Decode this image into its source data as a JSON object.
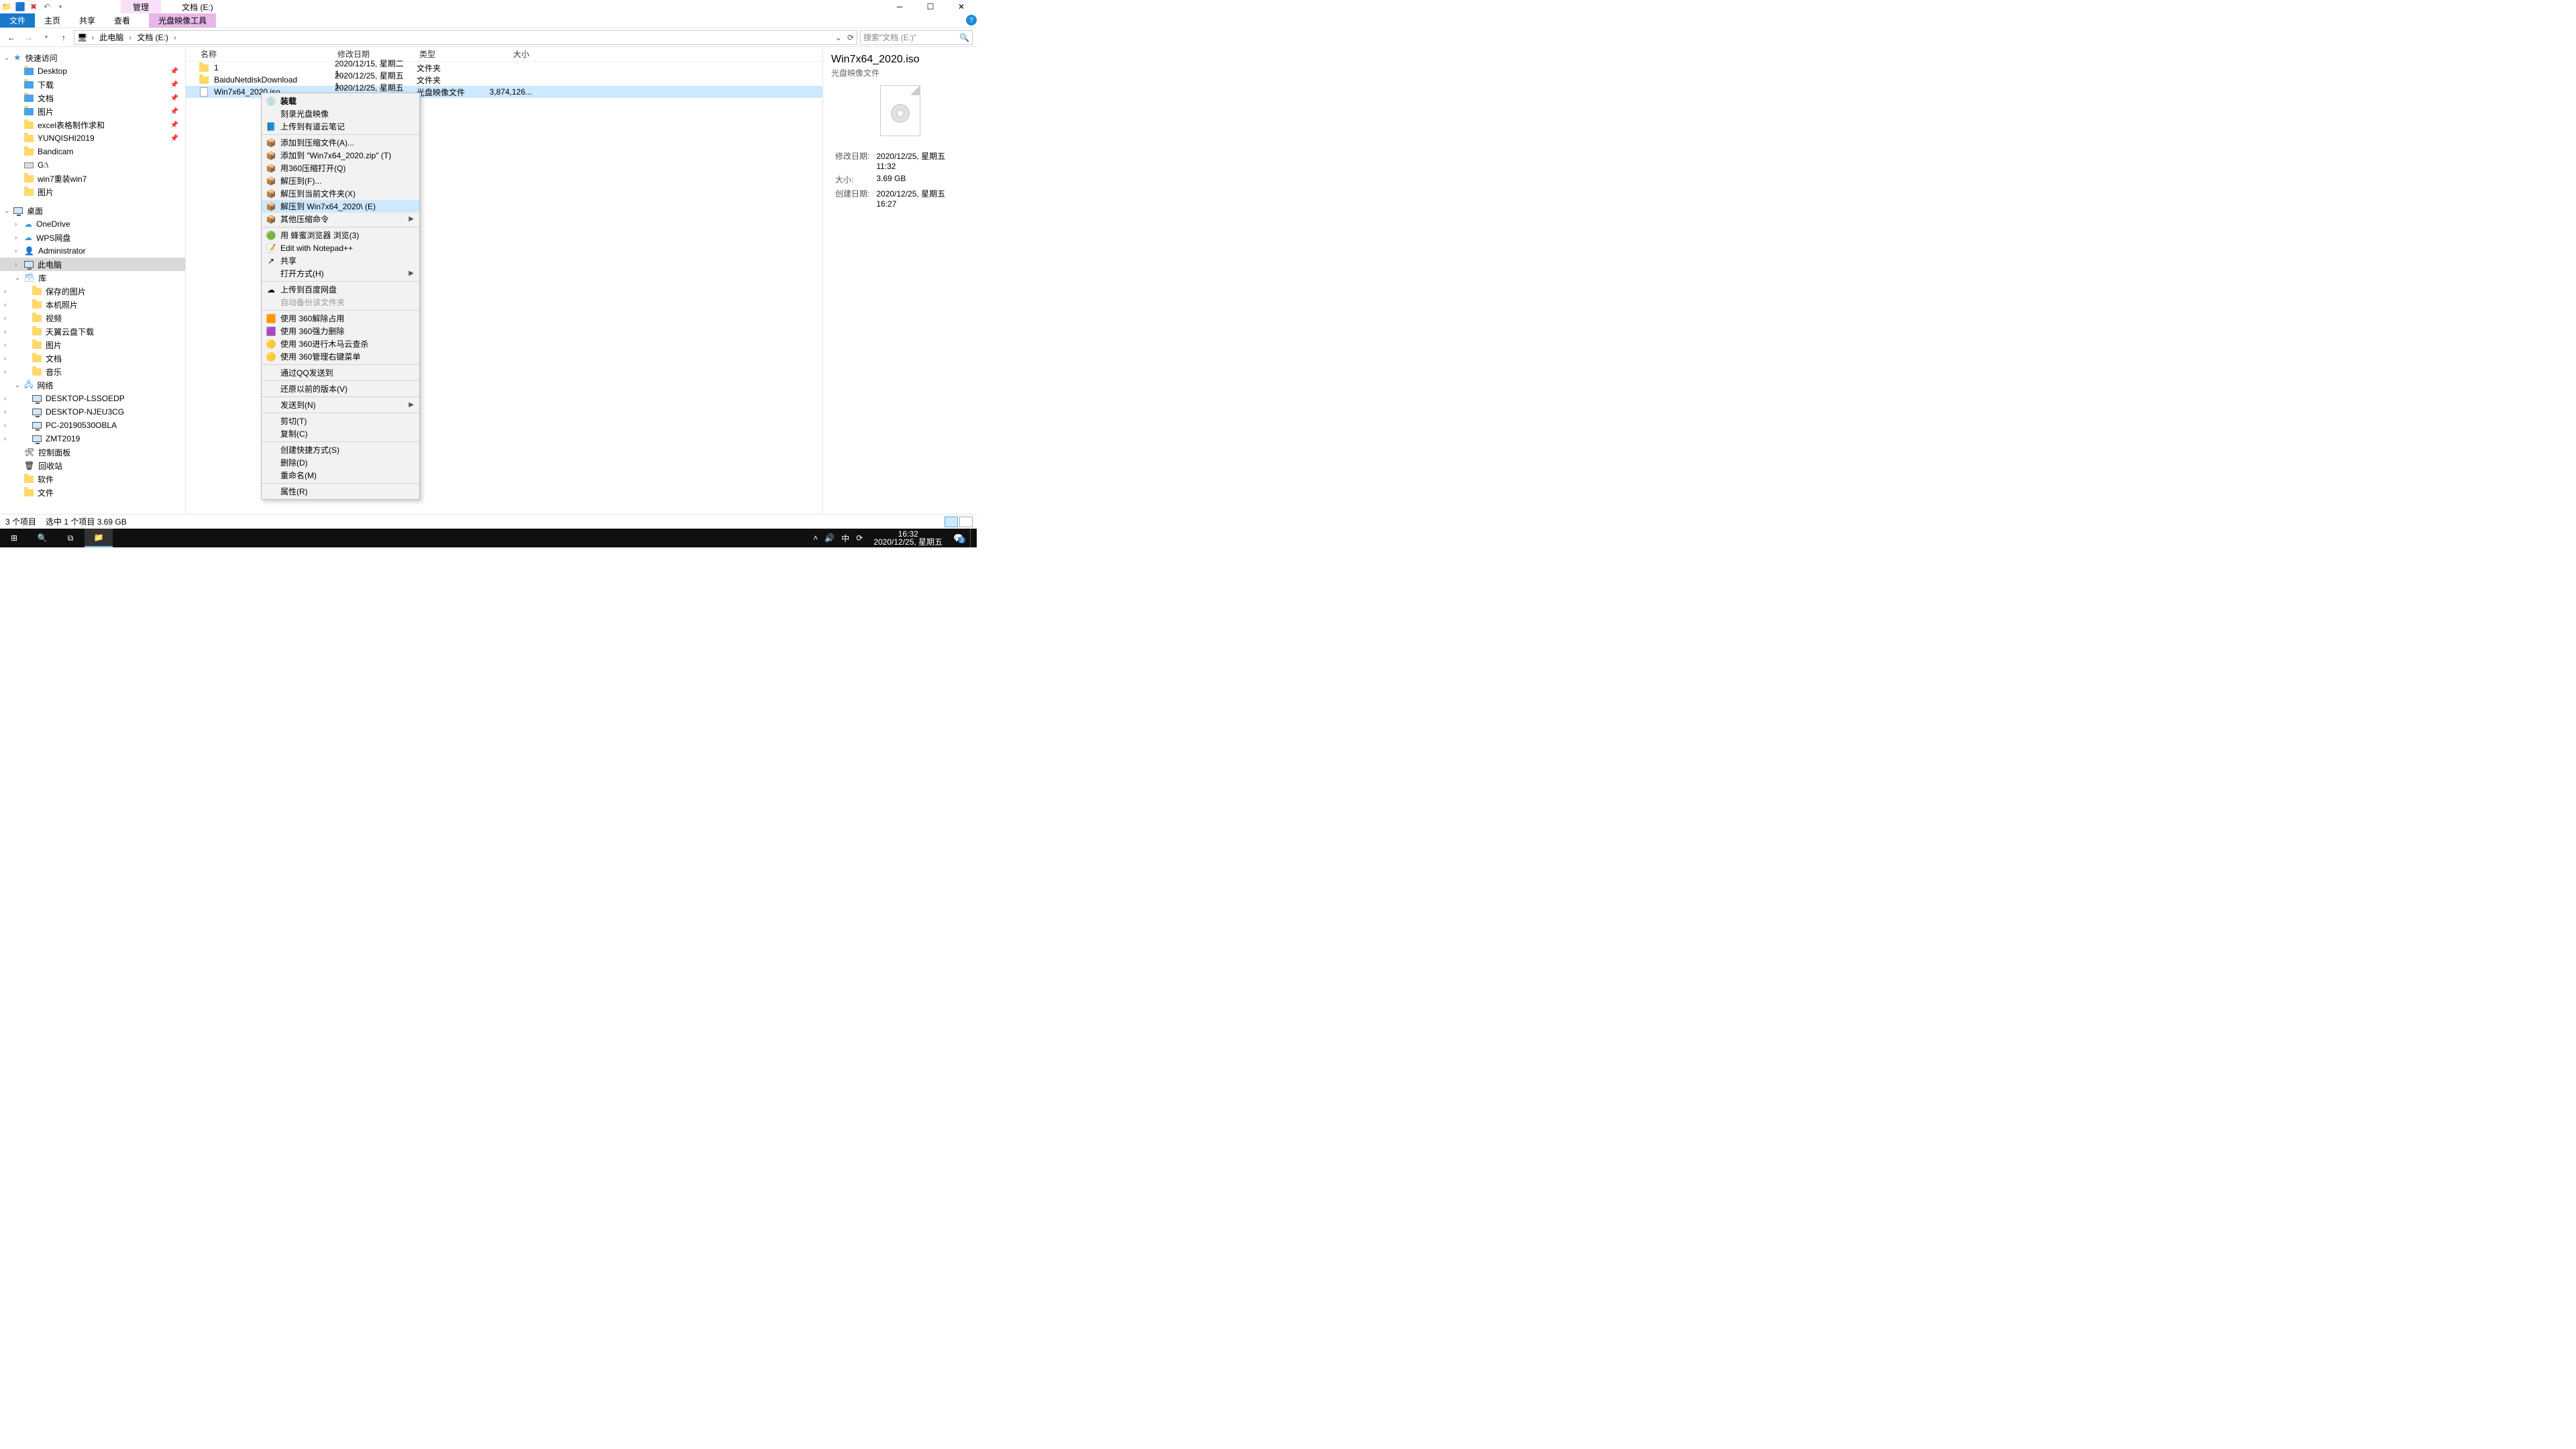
{
  "qat": {
    "manage_tab": "管理",
    "path_title": "文档 (E:)"
  },
  "ribbon": {
    "file": "文件",
    "home": "主页",
    "share": "共享",
    "view": "查看",
    "disc_tools": "光盘映像工具"
  },
  "nav": {
    "crumb_pc": "此电脑",
    "crumb_drive": "文档 (E:)",
    "search_placeholder": "搜索\"文档 (E:)\""
  },
  "columns": {
    "name": "名称",
    "date": "修改日期",
    "type": "类型",
    "size": "大小"
  },
  "rows": [
    {
      "name": "1",
      "date": "2020/12/15, 星期二 1...",
      "type": "文件夹",
      "size": "",
      "icon": "folder"
    },
    {
      "name": "BaiduNetdiskDownload",
      "date": "2020/12/25, 星期五 1...",
      "type": "文件夹",
      "size": "",
      "icon": "folder"
    },
    {
      "name": "Win7x64_2020.iso",
      "date": "2020/12/25, 星期五 1...",
      "type": "光盘映像文件",
      "size": "3,874,126...",
      "icon": "file",
      "selected": true
    }
  ],
  "tree": [
    {
      "t": "快速访问",
      "d": 0,
      "exp": "v",
      "ic": "star"
    },
    {
      "t": "Desktop",
      "d": 1,
      "pin": true,
      "ic": "folder-blue"
    },
    {
      "t": "下载",
      "d": 1,
      "pin": true,
      "ic": "folder-blue"
    },
    {
      "t": "文档",
      "d": 1,
      "pin": true,
      "ic": "folder-blue"
    },
    {
      "t": "图片",
      "d": 1,
      "pin": true,
      "ic": "folder-blue"
    },
    {
      "t": "excel表格制作求和",
      "d": 1,
      "pin": true,
      "ic": "folder"
    },
    {
      "t": "YUNQISHI2019",
      "d": 1,
      "pin": true,
      "ic": "folder"
    },
    {
      "t": "Bandicam",
      "d": 1,
      "ic": "folder"
    },
    {
      "t": "G:\\",
      "d": 1,
      "ic": "drive"
    },
    {
      "t": "win7重装win7",
      "d": 1,
      "ic": "folder"
    },
    {
      "t": "图片",
      "d": 1,
      "ic": "folder"
    },
    {
      "gap": true
    },
    {
      "t": "桌面",
      "d": 0,
      "exp": "v",
      "ic": "monitor"
    },
    {
      "t": "OneDrive",
      "d": 1,
      "exp": ">",
      "ic": "cloud"
    },
    {
      "t": "WPS网盘",
      "d": 1,
      "exp": ">",
      "ic": "cloud"
    },
    {
      "t": "Administrator",
      "d": 1,
      "exp": ">",
      "ic": "user"
    },
    {
      "t": "此电脑",
      "d": 1,
      "exp": ">",
      "ic": "monitor",
      "sel": true
    },
    {
      "t": "库",
      "d": 1,
      "exp": "v",
      "ic": "lib"
    },
    {
      "t": "保存的图片",
      "d": 2,
      "exp": ">",
      "ic": "folder"
    },
    {
      "t": "本机照片",
      "d": 2,
      "exp": ">",
      "ic": "folder"
    },
    {
      "t": "视频",
      "d": 2,
      "exp": ">",
      "ic": "folder"
    },
    {
      "t": "天翼云盘下载",
      "d": 2,
      "exp": ">",
      "ic": "folder"
    },
    {
      "t": "图片",
      "d": 2,
      "exp": ">",
      "ic": "folder"
    },
    {
      "t": "文档",
      "d": 2,
      "exp": ">",
      "ic": "folder"
    },
    {
      "t": "音乐",
      "d": 2,
      "exp": ">",
      "ic": "folder"
    },
    {
      "t": "网络",
      "d": 1,
      "exp": "v",
      "ic": "net"
    },
    {
      "t": "DESKTOP-LSSOEDP",
      "d": 2,
      "exp": ">",
      "ic": "monitor"
    },
    {
      "t": "DESKTOP-NJEU3CG",
      "d": 2,
      "exp": ">",
      "ic": "monitor"
    },
    {
      "t": "PC-20190530OBLA",
      "d": 2,
      "exp": ">",
      "ic": "monitor"
    },
    {
      "t": "ZMT2019",
      "d": 2,
      "exp": ">",
      "ic": "monitor"
    },
    {
      "t": "控制面板",
      "d": 1,
      "ic": "cp"
    },
    {
      "t": "回收站",
      "d": 1,
      "ic": "bin"
    },
    {
      "t": "软件",
      "d": 1,
      "ic": "folder"
    },
    {
      "t": "文件",
      "d": 1,
      "ic": "folder"
    }
  ],
  "details": {
    "name": "Win7x64_2020.iso",
    "type": "光盘映像文件",
    "rows": [
      [
        "修改日期:",
        "2020/12/25, 星期五 11:32"
      ],
      [
        "大小:",
        "3.69 GB"
      ],
      [
        "创建日期:",
        "2020/12/25, 星期五 16:27"
      ]
    ]
  },
  "status": {
    "count": "3 个项目",
    "sel": "选中 1 个项目  3.69 GB"
  },
  "taskbar": {
    "ime": "中",
    "time": "16:32",
    "date": "2020/12/25, 星期五"
  },
  "ctx": [
    {
      "t": "装载",
      "bold": true,
      "ic": "💿"
    },
    {
      "t": "刻录光盘映像"
    },
    {
      "t": "上传到有道云笔记",
      "ic": "📘"
    },
    {
      "sep": true
    },
    {
      "t": "添加到压缩文件(A)...",
      "ic": "📦"
    },
    {
      "t": "添加到 \"Win7x64_2020.zip\" (T)",
      "ic": "📦"
    },
    {
      "t": "用360压缩打开(Q)",
      "ic": "📦"
    },
    {
      "t": "解压到(F)...",
      "ic": "📦"
    },
    {
      "t": "解压到当前文件夹(X)",
      "ic": "📦"
    },
    {
      "t": "解压到 Win7x64_2020\\ (E)",
      "ic": "📦",
      "hl": true
    },
    {
      "t": "其他压缩命令",
      "ic": "📦",
      "sub": true
    },
    {
      "sep": true
    },
    {
      "t": "用 蜂蜜浏览器 浏览(3)",
      "ic": "🟢"
    },
    {
      "t": "Edit with Notepad++",
      "ic": "📝"
    },
    {
      "t": "共享",
      "ic": "↗"
    },
    {
      "t": "打开方式(H)",
      "sub": true
    },
    {
      "sep": true
    },
    {
      "t": "上传到百度网盘",
      "ic": "☁"
    },
    {
      "t": "自动备份该文件夹",
      "dis": true
    },
    {
      "sep": true
    },
    {
      "t": "使用 360解除占用",
      "ic": "🟧"
    },
    {
      "t": "使用 360强力删除",
      "ic": "🟪"
    },
    {
      "t": "使用 360进行木马云查杀",
      "ic": "🟡"
    },
    {
      "t": "使用 360管理右键菜单",
      "ic": "🟡"
    },
    {
      "sep": true
    },
    {
      "t": "通过QQ发送到"
    },
    {
      "sep": true
    },
    {
      "t": "还原以前的版本(V)"
    },
    {
      "sep": true
    },
    {
      "t": "发送到(N)",
      "sub": true
    },
    {
      "sep": true
    },
    {
      "t": "剪切(T)"
    },
    {
      "t": "复制(C)"
    },
    {
      "sep": true
    },
    {
      "t": "创建快捷方式(S)"
    },
    {
      "t": "删除(D)"
    },
    {
      "t": "重命名(M)"
    },
    {
      "sep": true
    },
    {
      "t": "属性(R)"
    }
  ]
}
